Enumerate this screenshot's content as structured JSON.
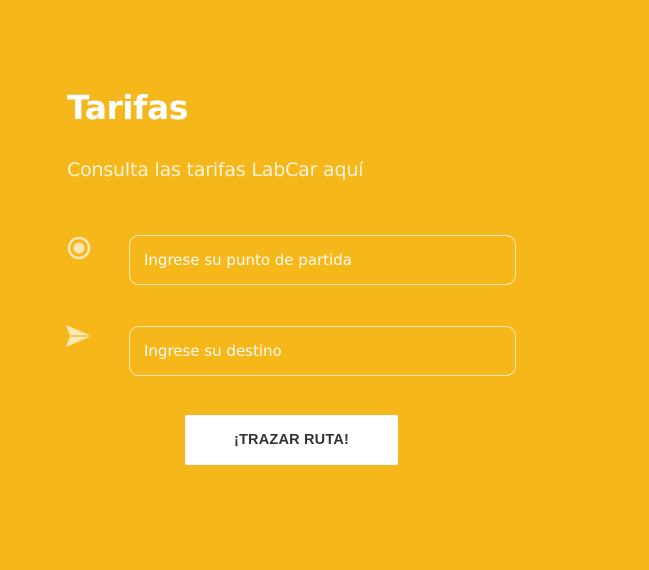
{
  "header": {
    "title": "Tarifas",
    "subtitle": "Consulta las tarifas LabCar aquí"
  },
  "form": {
    "origin": {
      "icon": "radio-target-icon",
      "value": "",
      "placeholder": "Ingrese su punto de partida"
    },
    "destination": {
      "icon": "paper-plane-icon",
      "value": "",
      "placeholder": "Ingrese su destino"
    },
    "submit_label": "¡TRAZAR RUTA!"
  },
  "colors": {
    "background": "#f6b71a",
    "text": "#ffffff",
    "field_border": "#fbe7b3",
    "button_bg": "#ffffff",
    "button_text": "#333333"
  }
}
